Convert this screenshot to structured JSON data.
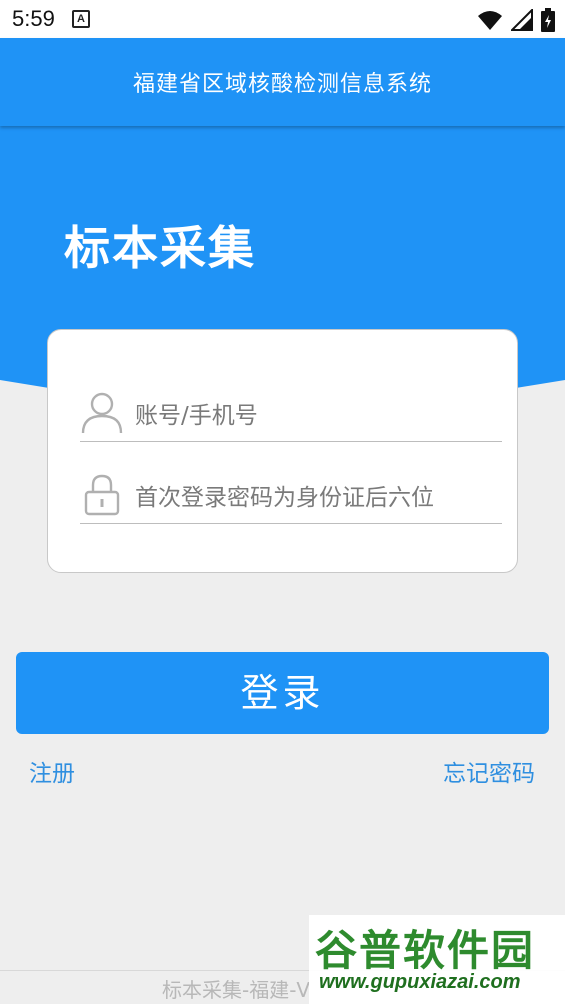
{
  "status_bar": {
    "time": "5:59",
    "notification_icon_letter": "A",
    "icons": [
      "wifi-icon",
      "signal-icon",
      "battery-icon"
    ]
  },
  "app_bar": {
    "title": "福建省区域核酸检测信息系统"
  },
  "hero": {
    "title": "标本采集"
  },
  "login_form": {
    "username_placeholder": "账号/手机号",
    "password_placeholder": "首次登录密码为身份证后六位",
    "icons": [
      "user-icon",
      "lock-icon"
    ]
  },
  "actions": {
    "login_label": "登录",
    "register_label": "注册",
    "forgot_label": "忘记密码"
  },
  "footer": {
    "text": "标本采集-福建-V"
  },
  "watermark": {
    "title": "谷普软件园",
    "url": "www.gupuxiazai.com"
  },
  "colors": {
    "primary": "#1f93f6",
    "background": "#eeeeee",
    "link": "#2f8fe0"
  }
}
